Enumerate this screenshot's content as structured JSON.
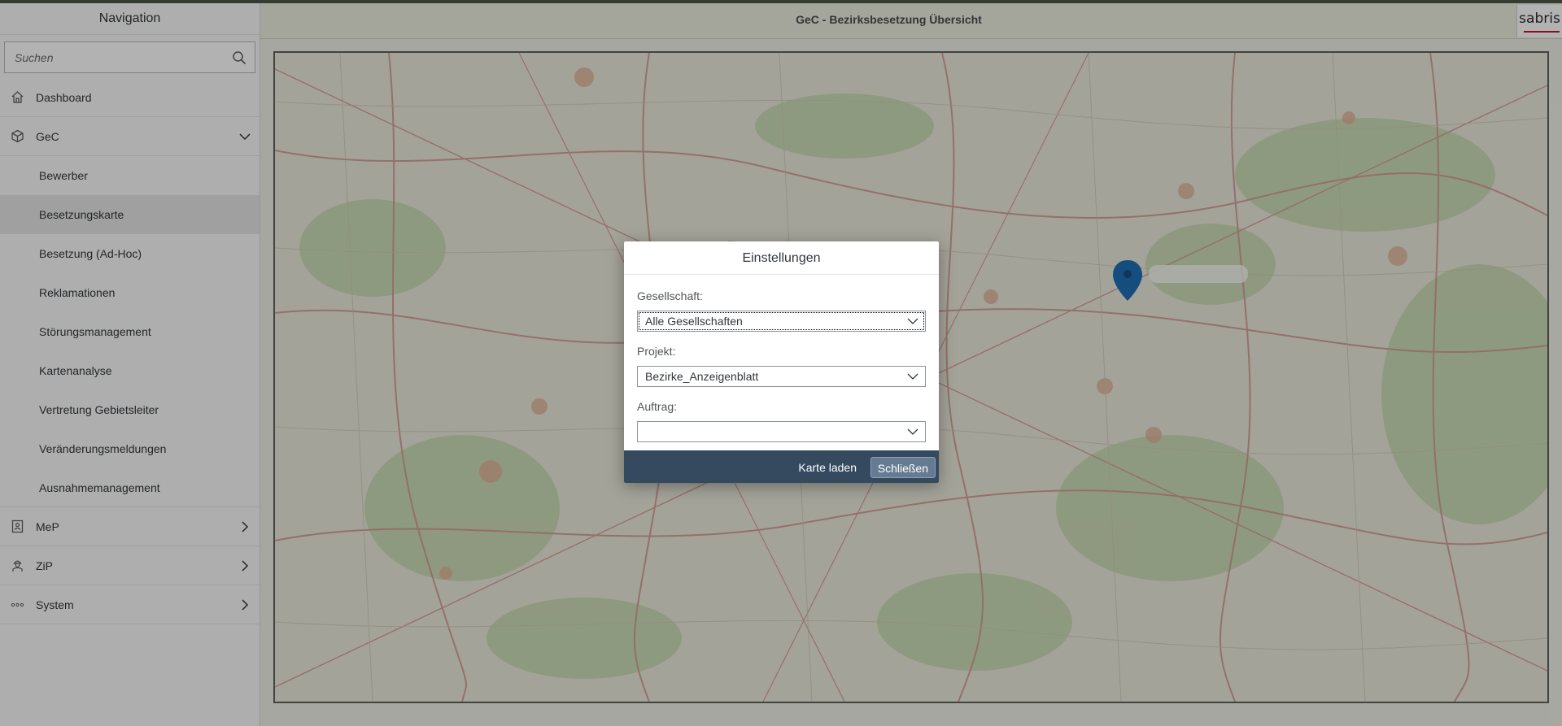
{
  "navigation": {
    "title": "Navigation",
    "search": {
      "placeholder": "Suchen",
      "value": ""
    },
    "items": [
      {
        "label": "Dashboard",
        "icon": "home-icon"
      },
      {
        "label": "GeC",
        "icon": "cube-icon",
        "expanded": true,
        "children": [
          {
            "label": "Bewerber"
          },
          {
            "label": "Besetzungskarte",
            "selected": true
          },
          {
            "label": "Besetzung (Ad-Hoc)"
          },
          {
            "label": "Reklamationen"
          },
          {
            "label": "Störungsmanagement"
          },
          {
            "label": "Kartenanalyse"
          },
          {
            "label": "Vertretung Gebietsleiter"
          },
          {
            "label": "Veränderungsmeldungen"
          },
          {
            "label": "Ausnahmemanagement"
          }
        ]
      },
      {
        "label": "MeP",
        "icon": "badge-icon"
      },
      {
        "label": "ZiP",
        "icon": "worker-icon"
      },
      {
        "label": "System",
        "icon": "dots-icon"
      }
    ]
  },
  "header": {
    "title": "GeC - Bezirksbesetzung Übersicht",
    "logo_text": "sabris"
  },
  "dialog": {
    "title": "Einstellungen",
    "fields": [
      {
        "label": "Gesellschaft:",
        "value": "Alle Gesellschaften"
      },
      {
        "label": "Projekt:",
        "value": "Bezirke_Anzeigenblatt"
      },
      {
        "label": "Auftrag:",
        "value": ""
      }
    ],
    "buttons": {
      "load": "Karte laden",
      "close": "Schließen"
    }
  },
  "colors": {
    "dialog_footer": "#354a5f",
    "close_button": "#667b91",
    "marker": "#1f6fb5",
    "header_bg": "#eceede"
  }
}
